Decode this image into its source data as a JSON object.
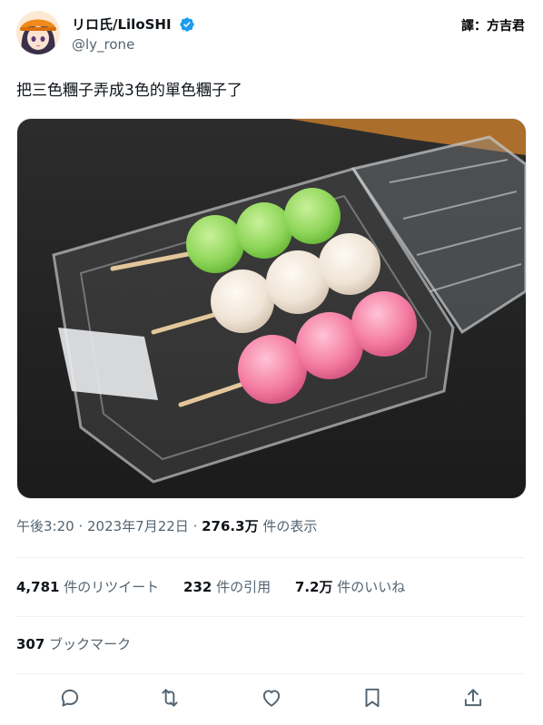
{
  "author": {
    "display_name": "リロ氏/LiloSHI",
    "handle": "@ly_rone",
    "verified_icon": "verified-badge-icon"
  },
  "translator_credit": "譯：方吉君",
  "tweet": {
    "text": "把三色糰子弄成3色的單色糰子了"
  },
  "meta": {
    "time": "午後3:20",
    "separator1": " · ",
    "date": "2023年7月22日",
    "separator2": " · ",
    "views_count": "276.3万",
    "views_label": " 件の表示"
  },
  "stats": {
    "retweets_count": "4,781",
    "retweets_label": " 件のリツイート",
    "quotes_count": "232",
    "quotes_label": " 件の引用",
    "likes_count": "7.2万",
    "likes_label": " 件のいいね"
  },
  "bookmarks": {
    "count": "307",
    "label": " ブックマーク"
  },
  "actions": [
    "reply-icon",
    "retweet-icon",
    "like-icon",
    "bookmark-icon",
    "share-icon"
  ],
  "colors": {
    "text_primary": "#0f1419",
    "text_secondary": "#536471",
    "verified_blue": "#1d9bf0",
    "divider": "#eff3f4"
  }
}
